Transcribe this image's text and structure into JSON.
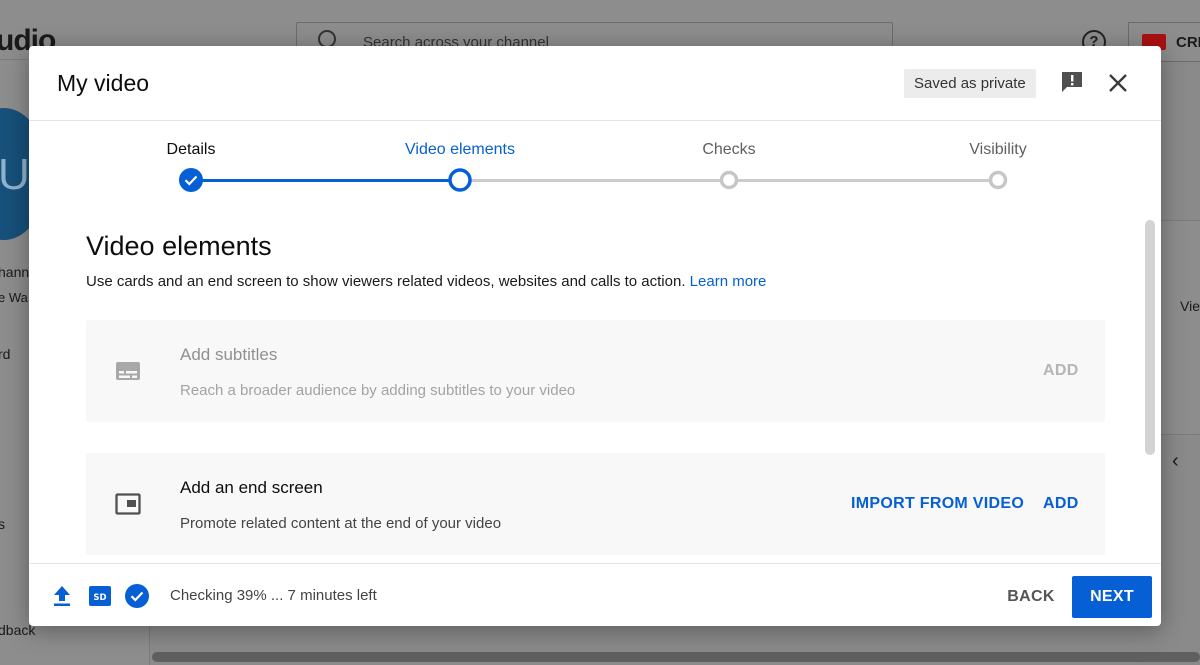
{
  "background": {
    "logo_fragment": "udio",
    "search_placeholder": "Search across your channel",
    "help_glyph": "?",
    "create_label": "CRE",
    "avatar_letter": "U",
    "sidebar_fragments": [
      "hann",
      "e Wa",
      "rd",
      "s",
      "dback"
    ],
    "right_fragment": "Vie",
    "right_chevron": "‹"
  },
  "dialog": {
    "title": "My video",
    "saved_status": "Saved as private"
  },
  "stepper": {
    "steps": [
      {
        "label": "Details",
        "state": "complete"
      },
      {
        "label": "Video elements",
        "state": "current"
      },
      {
        "label": "Checks",
        "state": "pending"
      },
      {
        "label": "Visibility",
        "state": "pending"
      }
    ]
  },
  "content": {
    "title": "Video elements",
    "description": "Use cards and an end screen to show viewers related videos, websites and calls to action.",
    "learn_more": "Learn more",
    "cards": [
      {
        "icon": "subtitles-icon",
        "title": "Add subtitles",
        "description": "Reach a broader audience by adding subtitles to your video",
        "actions": [
          "ADD"
        ],
        "enabled": false
      },
      {
        "icon": "end-screen-icon",
        "title": "Add an end screen",
        "description": "Promote related content at the end of your video",
        "actions": [
          "IMPORT FROM VIDEO",
          "ADD"
        ],
        "enabled": true
      }
    ]
  },
  "footer": {
    "status": "Checking 39% ... 7 minutes left",
    "icons": [
      "upload-icon",
      "sd-badge-icon",
      "check-circle-icon"
    ],
    "sd_label": "SD",
    "back_label": "BACK",
    "next_label": "NEXT"
  },
  "colors": {
    "accent": "#065fd4",
    "track_pending": "#cccccc",
    "disabled_text": "#909090"
  }
}
